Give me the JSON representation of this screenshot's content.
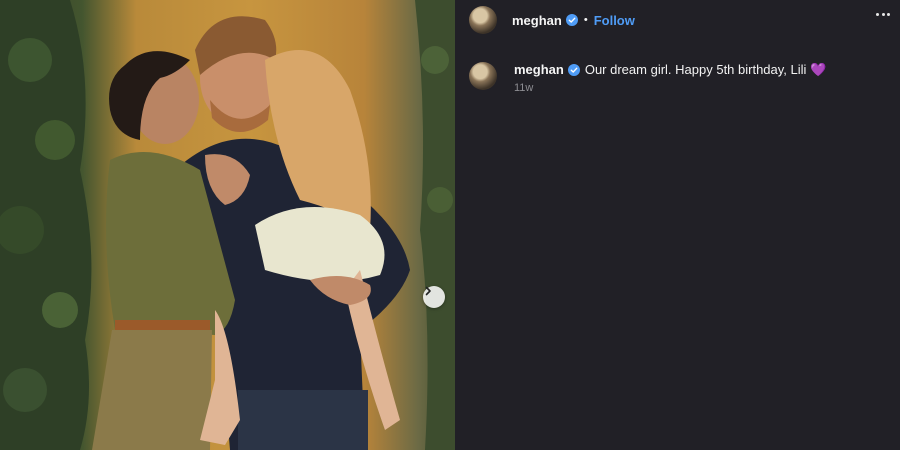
{
  "post": {
    "username": "meghan",
    "separator": "•",
    "follow_label": "Follow",
    "caption_text": "Our dream girl. Happy 5th birthday, Lili 💜",
    "timestamp": "11w"
  },
  "icons": {
    "verified": "verified-badge-icon",
    "more": "more-options-icon",
    "next": "chevron-right-icon"
  },
  "colors": {
    "panel_bg": "#212026",
    "accent": "#4f9cf6",
    "verified": "#4f9cf6",
    "muted_text": "#8e8e93"
  }
}
